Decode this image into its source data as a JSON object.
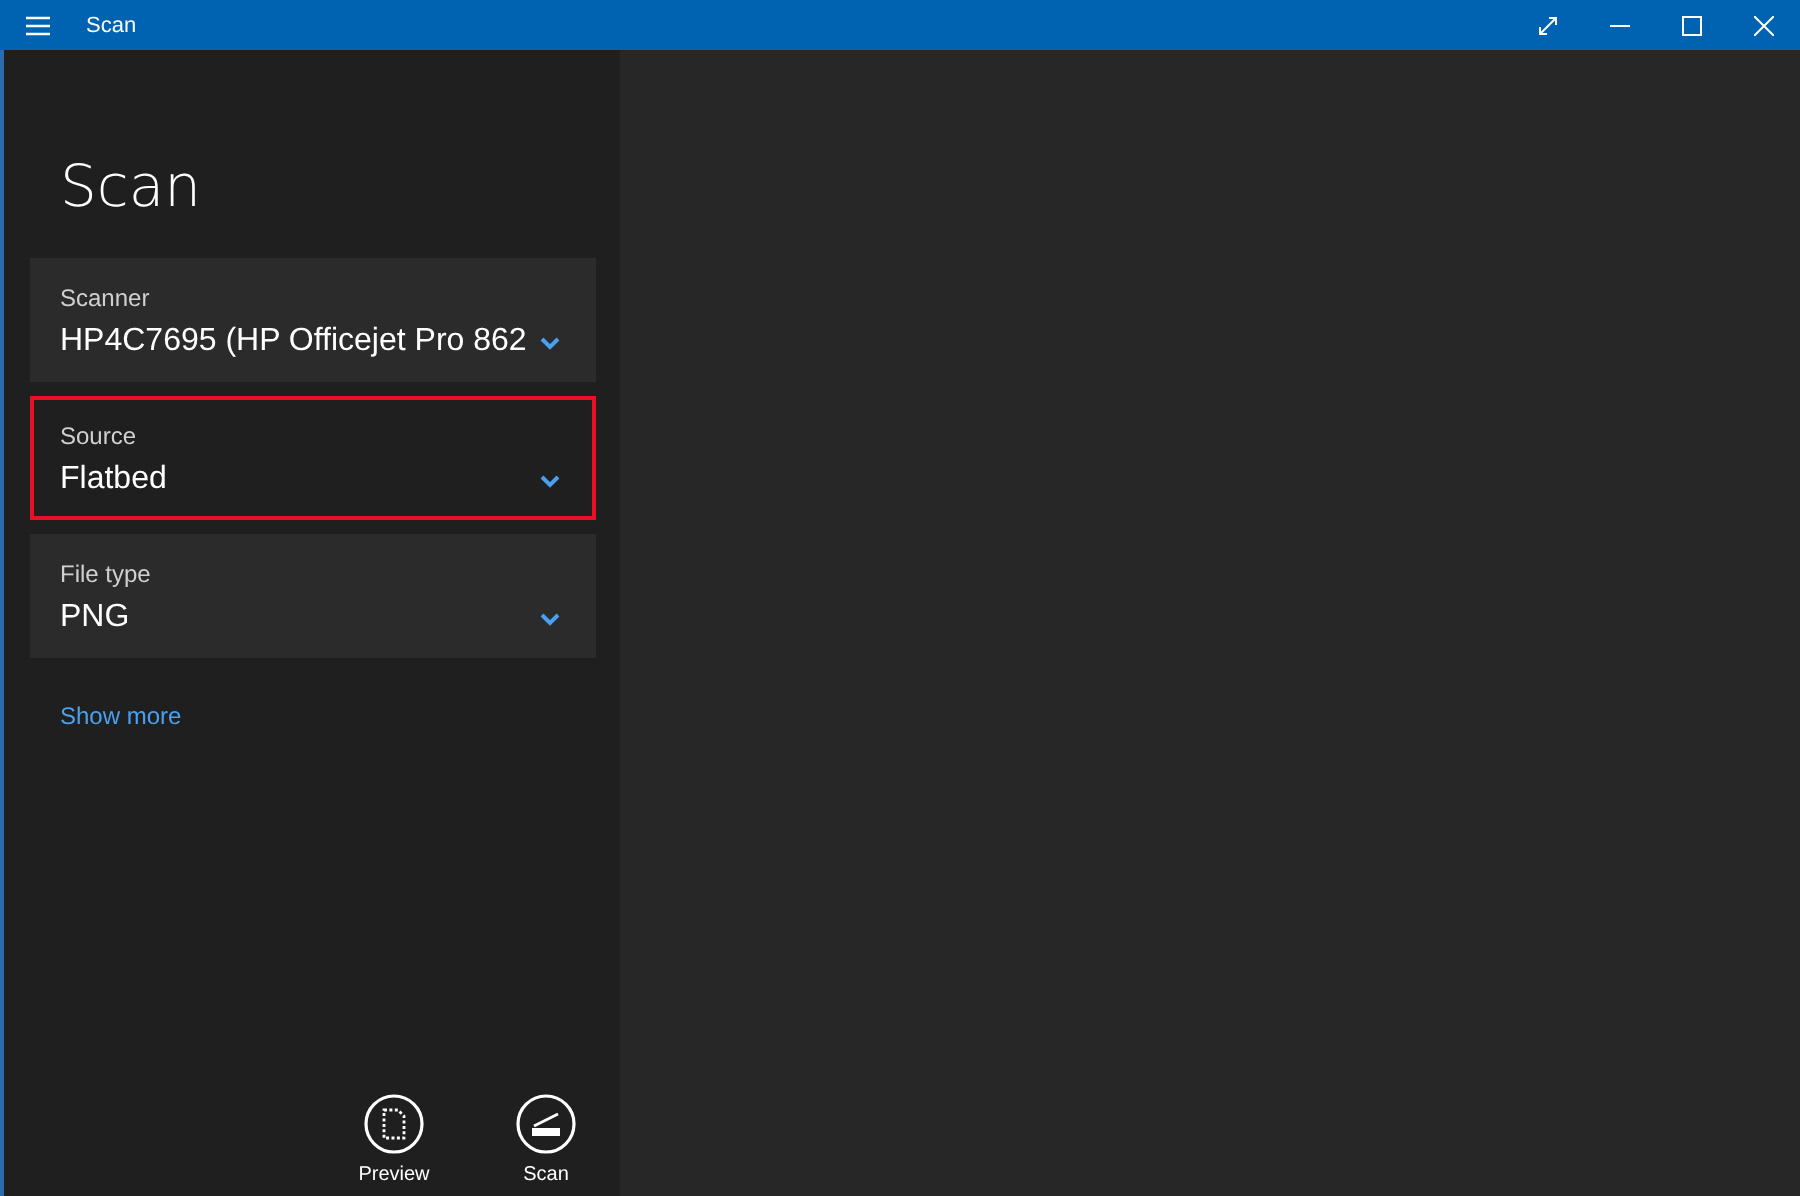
{
  "window": {
    "title": "Scan"
  },
  "heading": "Scan",
  "dropdowns": [
    {
      "label": "Scanner",
      "value": "HP4C7695 (HP Officejet Pro 862",
      "highlighted": false
    },
    {
      "label": "Source",
      "value": "Flatbed",
      "highlighted": true
    },
    {
      "label": "File type",
      "value": "PNG",
      "highlighted": false
    }
  ],
  "show_more": "Show more",
  "actions": [
    {
      "kind": "preview",
      "label": "Preview"
    },
    {
      "kind": "scan",
      "label": "Scan"
    }
  ]
}
